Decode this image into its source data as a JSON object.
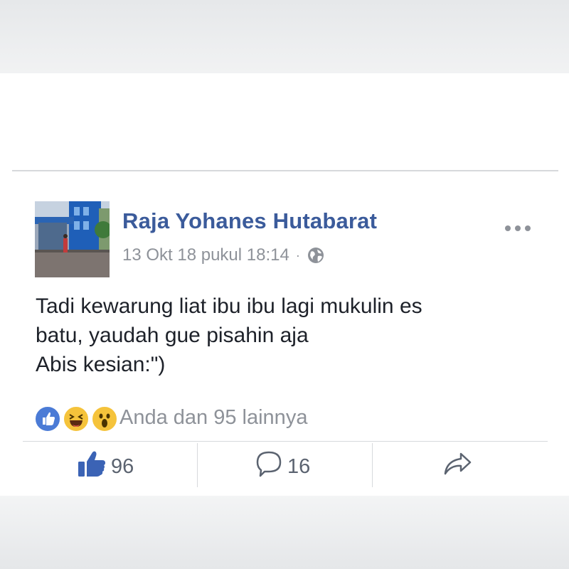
{
  "post": {
    "author": "Raja Yohanes Hutabarat",
    "timestamp": "13 Okt 18 pukul 18:14",
    "separator": "·",
    "privacy_icon": "globe-icon",
    "body_lines": [
      "Tadi kewarung liat ibu ibu lagi mukulin es",
      "batu, yaudah gue pisahin aja",
      "Abis kesian:\")"
    ]
  },
  "reactions": {
    "icons": [
      "like-reaction-icon",
      "haha-reaction-icon",
      "wow-reaction-icon"
    ],
    "summary": "Anda dan 95 lainnya"
  },
  "actions": {
    "like_count": "96",
    "comment_count": "16",
    "share_icon": "share-icon"
  },
  "colors": {
    "author_blue": "#3b5b9b",
    "like_blue": "#3b63b5",
    "muted_text": "#8e9299",
    "body_text": "#1d2129"
  }
}
